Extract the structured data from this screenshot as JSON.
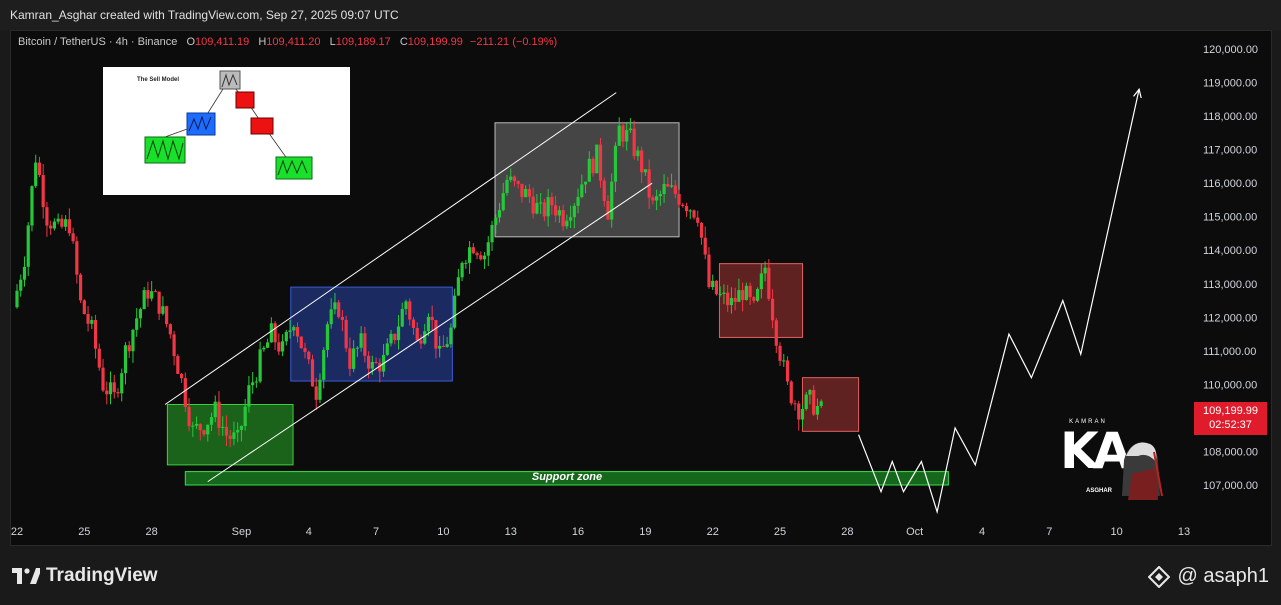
{
  "header": {
    "attribution": "Kamran_Asghar created with TradingView.com, Sep 27, 2025 09:07 UTC"
  },
  "legend": {
    "symbol": "Bitcoin / TetherUS · 4h · Binance",
    "open_label": "O",
    "open": "109,411.19",
    "high_label": "H",
    "high": "109,411.20",
    "low_label": "L",
    "low": "109,189.17",
    "close_label": "C",
    "close": "109,199.99",
    "change": "−211.21 (−0.19%)"
  },
  "price_tag": {
    "price": "109,199.99",
    "countdown": "02:52:37"
  },
  "inset": {
    "title": "The Sell Model"
  },
  "support": {
    "label": "Support zone"
  },
  "badge": {
    "top": "KAMRAN",
    "letters": "KA",
    "bottom": "ASGHAR"
  },
  "footer": {
    "logo_text": "TradingView",
    "handle": "@ asaph1"
  },
  "colors": {
    "up": "#26c73a",
    "down": "#f23645",
    "bg": "#0c0c0c",
    "accent": "#e01c2c"
  },
  "chart_data": {
    "type": "candlestick",
    "pair": "BTC/USDT",
    "timeframe": "4h",
    "ylim": [
      106200,
      120600
    ],
    "y_ticks": [
      107000,
      108000,
      109000,
      110000,
      111000,
      112000,
      113000,
      114000,
      115000,
      116000,
      117000,
      118000,
      119000,
      120000
    ],
    "y_tick_labels": [
      "107,000.00",
      "108,000.00",
      "109,000.00",
      "110,000.00",
      "111,000.00",
      "112,000.00",
      "113,000.00",
      "114,000.00",
      "115,000.00",
      "116,000.00",
      "117,000.00",
      "118,000.00",
      "119,000.00",
      "120,000.00"
    ],
    "x_ticks": [
      {
        "day": 22,
        "label": "22"
      },
      {
        "day": 25,
        "label": "25"
      },
      {
        "day": 28,
        "label": "28"
      },
      {
        "day": 32,
        "label": "Sep"
      },
      {
        "day": 35,
        "label": "4"
      },
      {
        "day": 38,
        "label": "7"
      },
      {
        "day": 41,
        "label": "10"
      },
      {
        "day": 44,
        "label": "13"
      },
      {
        "day": 47,
        "label": "16"
      },
      {
        "day": 50,
        "label": "19"
      },
      {
        "day": 53,
        "label": "22"
      },
      {
        "day": 56,
        "label": "25"
      },
      {
        "day": 59,
        "label": "28"
      },
      {
        "day": 62,
        "label": "Oct"
      },
      {
        "day": 65,
        "label": "4"
      },
      {
        "day": 68,
        "label": "7"
      },
      {
        "day": 71,
        "label": "10"
      },
      {
        "day": 74,
        "label": "13"
      }
    ],
    "price_path": [
      [
        22,
        112300
      ],
      [
        22.5,
        113800
      ],
      [
        23,
        116800
      ],
      [
        23.5,
        115000
      ],
      [
        24,
        114600
      ],
      [
        24.5,
        114800
      ],
      [
        25,
        112400
      ],
      [
        25.5,
        111600
      ],
      [
        26,
        110000
      ],
      [
        26.5,
        109600
      ],
      [
        27,
        111000
      ],
      [
        27.5,
        112000
      ],
      [
        28,
        112800
      ],
      [
        28.5,
        112400
      ],
      [
        29,
        111500
      ],
      [
        29.5,
        110100
      ],
      [
        30,
        108600
      ],
      [
        30.5,
        108800
      ],
      [
        31,
        109200
      ],
      [
        31.5,
        108500
      ],
      [
        32,
        108300
      ],
      [
        32.5,
        109800
      ],
      [
        33,
        110700
      ],
      [
        33.5,
        111500
      ],
      [
        34,
        111000
      ],
      [
        34.5,
        112000
      ],
      [
        35,
        110800
      ],
      [
        35.5,
        109800
      ],
      [
        36,
        111800
      ],
      [
        36.5,
        112300
      ],
      [
        37,
        110700
      ],
      [
        37.5,
        111200
      ],
      [
        38,
        110500
      ],
      [
        38.5,
        110700
      ],
      [
        39,
        111500
      ],
      [
        39.5,
        112500
      ],
      [
        40,
        111200
      ],
      [
        40.5,
        112300
      ],
      [
        41,
        110800
      ],
      [
        41.5,
        111600
      ],
      [
        42,
        113800
      ],
      [
        42.5,
        114200
      ],
      [
        43,
        113900
      ],
      [
        43.5,
        115000
      ],
      [
        44,
        116100
      ],
      [
        44.5,
        115800
      ],
      [
        45,
        115600
      ],
      [
        45.5,
        115100
      ],
      [
        46,
        115400
      ],
      [
        46.5,
        115000
      ],
      [
        47,
        115500
      ],
      [
        47.5,
        116300
      ],
      [
        48,
        116800
      ],
      [
        48.5,
        115200
      ],
      [
        49,
        117600
      ],
      [
        49.5,
        117300
      ],
      [
        50,
        116500
      ],
      [
        50.5,
        115300
      ],
      [
        51,
        115800
      ],
      [
        51.5,
        115700
      ],
      [
        52,
        115400
      ],
      [
        52.5,
        115100
      ],
      [
        53,
        112900
      ],
      [
        53.5,
        112600
      ],
      [
        54,
        112400
      ],
      [
        54.5,
        112800
      ],
      [
        55,
        112200
      ],
      [
        55.5,
        113500
      ],
      [
        56,
        111500
      ],
      [
        56.5,
        109900
      ],
      [
        57,
        109300
      ],
      [
        57.5,
        109500
      ],
      [
        58,
        109200
      ]
    ],
    "annotations": {
      "green_box": {
        "x": [
          28.7,
          34.3
        ],
        "y": [
          107600,
          109400
        ]
      },
      "blue_box": {
        "x": [
          34.2,
          41.4
        ],
        "y": [
          110100,
          112900
        ]
      },
      "grey_box": {
        "x": [
          43.3,
          51.5
        ],
        "y": [
          114400,
          117800
        ]
      },
      "red_box_1": {
        "x": [
          53.3,
          57.0
        ],
        "y": [
          111400,
          113600
        ]
      },
      "red_box_2": {
        "x": [
          57.0,
          59.5
        ],
        "y": [
          108600,
          110200
        ]
      },
      "support_zone": {
        "x": [
          29.5,
          63.5
        ],
        "y": [
          107000,
          107400
        ]
      },
      "channel_upper": [
        [
          28.6,
          109400
        ],
        [
          48.7,
          118700
        ]
      ],
      "channel_lower": [
        [
          30.5,
          107100
        ],
        [
          50.3,
          116000
        ]
      ],
      "projection": [
        [
          59.5,
          108500
        ],
        [
          60.5,
          106800
        ],
        [
          61,
          107700
        ],
        [
          61.5,
          106800
        ],
        [
          62.3,
          107700
        ],
        [
          63,
          106200
        ],
        [
          63.8,
          108700
        ],
        [
          64.7,
          107600
        ],
        [
          66.2,
          111500
        ],
        [
          67.2,
          110200
        ],
        [
          68.6,
          112500
        ],
        [
          69.4,
          110900
        ],
        [
          72,
          118800
        ]
      ]
    }
  }
}
